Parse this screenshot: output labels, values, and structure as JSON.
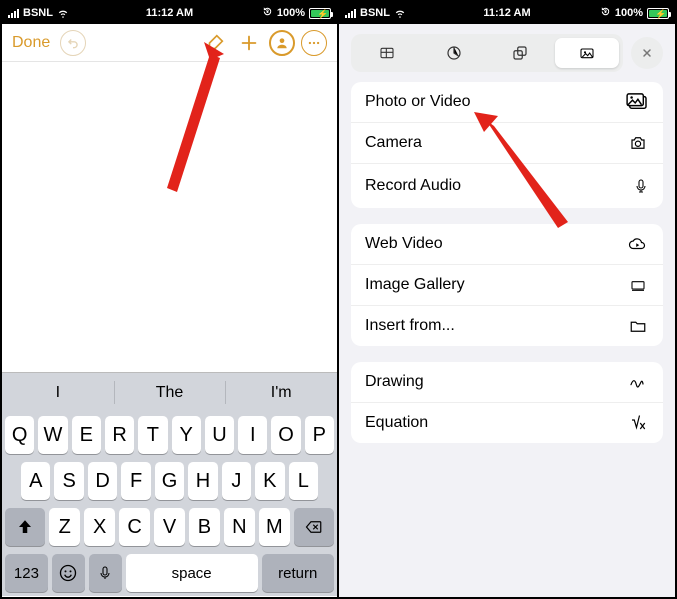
{
  "status": {
    "carrier": "BSNL",
    "time": "11:12 AM",
    "battery": "100%"
  },
  "left": {
    "done": "Done",
    "suggestions": [
      "I",
      "The",
      "I'm"
    ],
    "keys_r1": [
      "Q",
      "W",
      "E",
      "R",
      "T",
      "Y",
      "U",
      "I",
      "O",
      "P"
    ],
    "keys_r2": [
      "A",
      "S",
      "D",
      "F",
      "G",
      "H",
      "J",
      "K",
      "L"
    ],
    "keys_r3": [
      "Z",
      "X",
      "C",
      "V",
      "B",
      "N",
      "M"
    ],
    "k123": "123",
    "space": "space",
    "return": "return"
  },
  "right": {
    "group1": {
      "photo": "Photo or Video",
      "camera": "Camera",
      "record": "Record Audio"
    },
    "group2": {
      "web": "Web Video",
      "gallery": "Image Gallery",
      "insert": "Insert from..."
    },
    "group3": {
      "drawing": "Drawing",
      "equation": "Equation"
    }
  }
}
